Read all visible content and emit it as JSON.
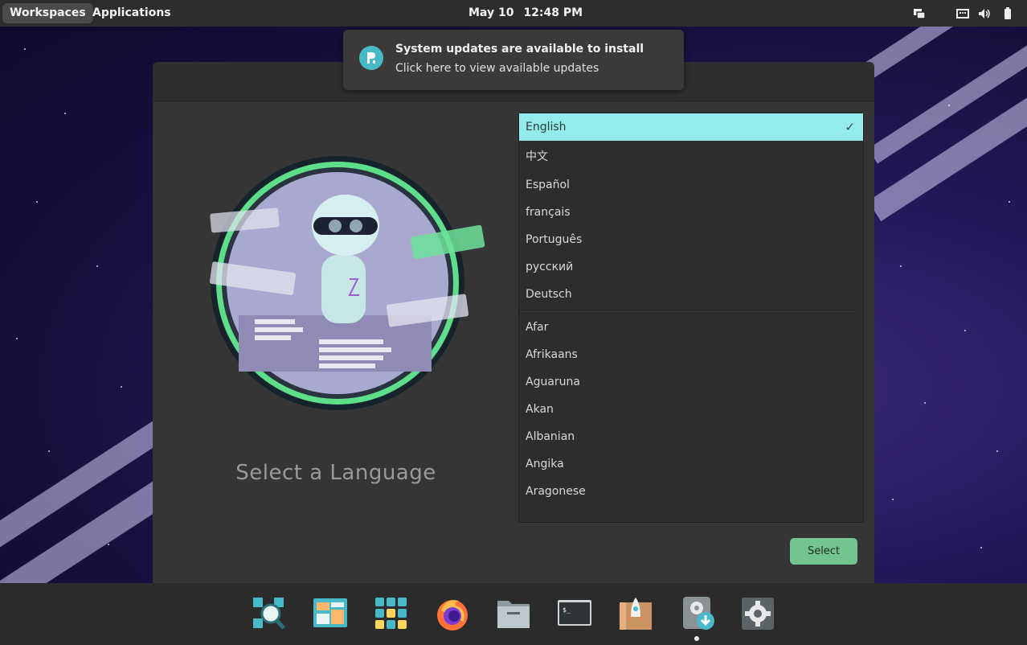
{
  "topbar": {
    "workspaces": "Workspaces",
    "applications": "Applications",
    "date": "May 10",
    "time": "12:48 PM"
  },
  "tray_icons": [
    "display-icon",
    "keyboard-icon",
    "volume-icon",
    "battery-icon"
  ],
  "notification": {
    "title": "System updates are available to install",
    "body": "Click here to view available updates",
    "icon": "pop-shop-icon"
  },
  "installer": {
    "heading": "Select a Language",
    "select_button": "Select",
    "languages_primary": [
      "English",
      "中文",
      "Español",
      "français",
      "Português",
      "русский",
      "Deutsch"
    ],
    "languages_all": [
      "Afar",
      "Afrikaans",
      "Aguaruna",
      "Akan",
      "Albanian",
      "Angika",
      "Aragonese"
    ],
    "selected": "English"
  },
  "dock": [
    "search-icon",
    "workspaces-icon",
    "app-grid-icon",
    "firefox-icon",
    "files-icon",
    "terminal-icon",
    "pop-shop-icon",
    "installer-icon",
    "settings-icon"
  ],
  "colors": {
    "selected_row": "#94ebeb",
    "select_button": "#73c48f",
    "topbar": "#2d2d2d",
    "window": "#353535"
  }
}
